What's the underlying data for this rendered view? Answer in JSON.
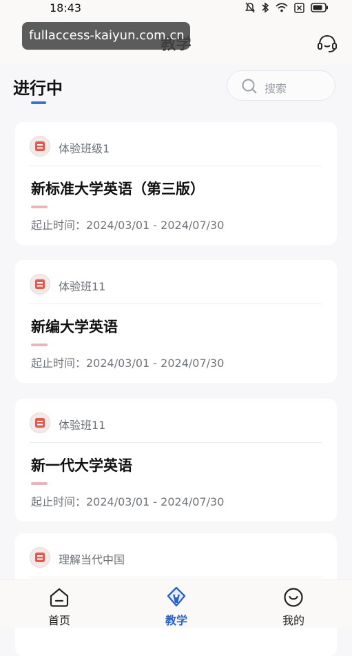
{
  "status_bar": {
    "time": "18:43"
  },
  "header": {
    "title": "教学",
    "url_overlay": "fullaccess-kaiyun.com.cn"
  },
  "section": {
    "title": "进行中"
  },
  "search": {
    "placeholder": "搜索"
  },
  "courses": [
    {
      "class_name": "体验班级1",
      "course_title": "新标准大学英语（第三版）",
      "dates": "起止时间：2024/03/01 - 2024/07/30"
    },
    {
      "class_name": "体验班11",
      "course_title": "新编大学英语",
      "dates": "起止时间：2024/03/01 - 2024/07/30"
    },
    {
      "class_name": "体验班11",
      "course_title": "新一代大学英语",
      "dates": "起止时间：2024/03/01 - 2024/07/30"
    },
    {
      "class_name": "理解当代中国",
      "course_title": "",
      "dates": ""
    }
  ],
  "tab_bar": {
    "tabs": [
      {
        "label": "首页",
        "icon": "home-icon",
        "active": false
      },
      {
        "label": "教学",
        "icon": "teaching-icon",
        "active": true
      },
      {
        "label": "我的",
        "icon": "profile-icon",
        "active": false
      }
    ]
  },
  "colors": {
    "accent": "#2a62cc",
    "tab_active": "#2a62cc",
    "badge": "#e05a4f",
    "course_accent": "#e8b6b6"
  }
}
